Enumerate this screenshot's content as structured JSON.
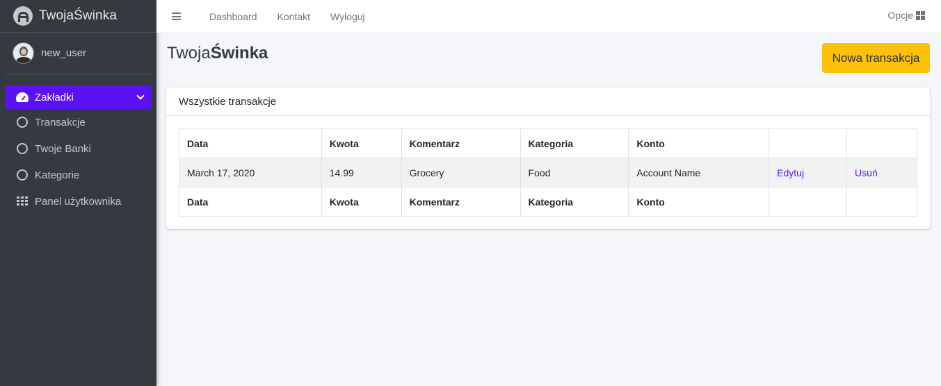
{
  "brand": {
    "prefix": "Twoja",
    "suffix": "Świnka"
  },
  "user": {
    "name": "new_user"
  },
  "sidebar": {
    "items": [
      {
        "label": "Zakładki",
        "icon": "tachometer-icon",
        "active": true
      },
      {
        "label": "Transakcje",
        "icon": "circle-icon"
      },
      {
        "label": "Twoje Banki",
        "icon": "circle-icon"
      },
      {
        "label": "Kategorie",
        "icon": "circle-icon"
      },
      {
        "label": "Panel użytkownika",
        "icon": "grid-icon"
      }
    ]
  },
  "topbar": {
    "links": [
      "Dashboard",
      "Kontakt",
      "Wyloguj"
    ],
    "options_label": "Opcje"
  },
  "page": {
    "title_prefix": "Twoja",
    "title_bold": "Świnka",
    "new_button": "Nowa transakcja"
  },
  "card": {
    "title": "Wszystkie transakcje",
    "columns": [
      "Data",
      "Kwota",
      "Komentarz",
      "Kategoria",
      "Konto",
      "",
      ""
    ],
    "rows": [
      {
        "date": "March 17, 2020",
        "amount": "14.99",
        "comment": "Grocery",
        "category": "Food",
        "account": "Account Name",
        "edit": "Edytuj",
        "delete": "Usuń"
      }
    ],
    "footer_columns": [
      "Data",
      "Kwota",
      "Komentarz",
      "Kategoria",
      "Konto",
      "",
      ""
    ]
  },
  "colors": {
    "accent": "#5a11f5",
    "button": "#ffc107",
    "sidebar": "#343a40"
  }
}
